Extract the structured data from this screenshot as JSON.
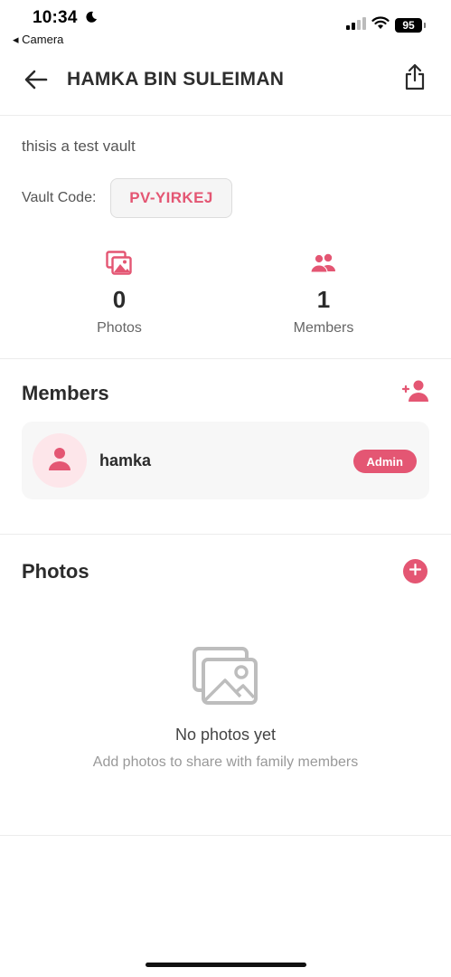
{
  "status_bar": {
    "time": "10:34",
    "back_app": "◂ Camera",
    "battery": "95"
  },
  "header": {
    "title": "HAMKA BIN SULEIMAN",
    "back_icon": "arrow-left-icon",
    "share_icon": "share-icon"
  },
  "vault": {
    "description": "thisis a test vault",
    "code_label": "Vault Code:",
    "code": "PV-YIRKEJ"
  },
  "stats": [
    {
      "icon": "photos-icon",
      "value": "0",
      "label": "Photos"
    },
    {
      "icon": "members-icon",
      "value": "1",
      "label": "Members"
    }
  ],
  "members_section": {
    "title": "Members",
    "add_icon": "add-member-icon",
    "members": [
      {
        "name": "hamka",
        "role": "Admin",
        "avatar_icon": "user-icon"
      }
    ]
  },
  "photos_section": {
    "title": "Photos",
    "add_icon": "plus-icon",
    "empty_title": "No photos yet",
    "empty_subtitle": "Add photos to share with family members"
  },
  "colors": {
    "accent": "#e45673",
    "avatar_bg": "#fde6ea",
    "card_bg": "#f7f7f7",
    "divider": "#ececec"
  }
}
